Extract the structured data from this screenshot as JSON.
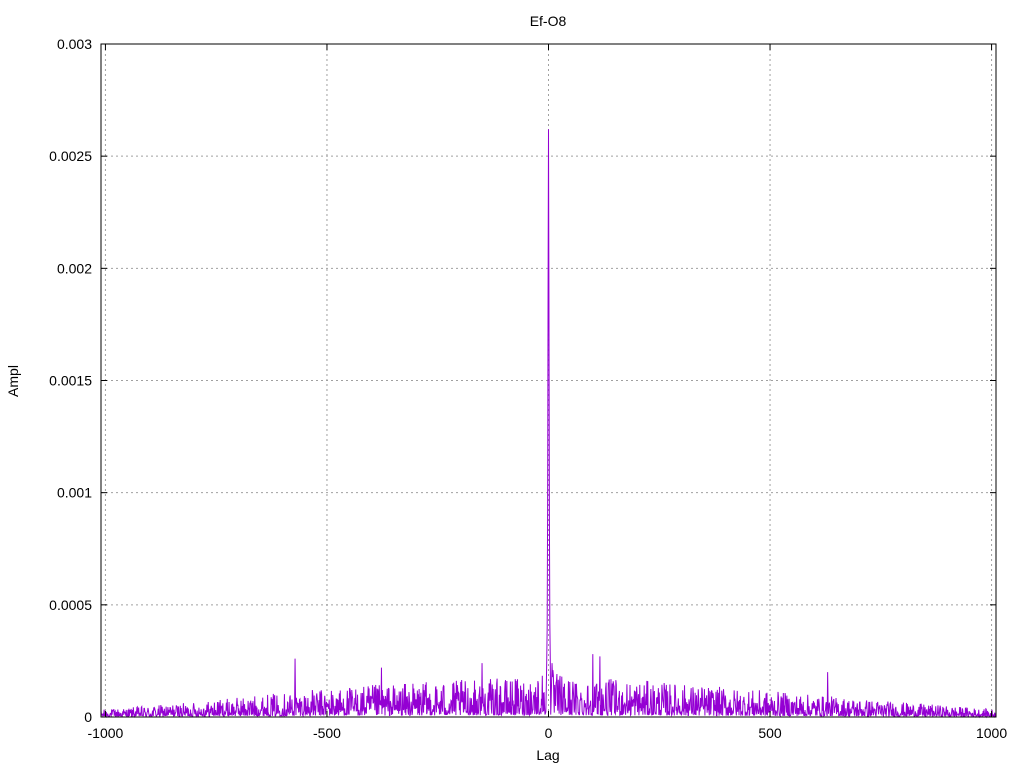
{
  "chart_data": {
    "type": "line",
    "title": "Ef-O8",
    "xlabel": "Lag",
    "ylabel": "Ampl",
    "xlim": [
      -1010,
      1010
    ],
    "ylim": [
      0,
      0.003
    ],
    "grid": true,
    "x_ticks": [
      "-1000",
      "-500",
      "0",
      "500",
      "1000"
    ],
    "y_ticks": [
      "0",
      "0.0005",
      "0.001",
      "0.0015",
      "0.002",
      "0.0025",
      "0.003"
    ],
    "series": [
      {
        "color": "#9400d3",
        "noise_profile": {
          "lag_min": -1010,
          "lag_max": 1010,
          "envelope_lags": [
            -1010,
            -800,
            -600,
            -400,
            -200,
            -50,
            0,
            50,
            200,
            400,
            600,
            800,
            1010
          ],
          "envelope_ampl": [
            3e-05,
            6e-05,
            0.0001,
            0.00013,
            0.00015,
            0.00016,
            0.0002,
            0.00016,
            0.00015,
            0.00012,
            9e-05,
            6e-05,
            3e-05
          ]
        },
        "peaks": [
          {
            "x": -4,
            "y": 0.00025
          },
          {
            "x": -3,
            "y": 0.0004
          },
          {
            "x": -2,
            "y": 0.00092
          },
          {
            "x": -1,
            "y": 0.00187
          },
          {
            "x": 0,
            "y": 0.00262
          },
          {
            "x": 1,
            "y": 0.00186
          },
          {
            "x": 2,
            "y": 0.0009
          },
          {
            "x": 3,
            "y": 0.00042
          },
          {
            "x": 4,
            "y": 0.00026
          },
          {
            "x": 8,
            "y": 0.00024
          },
          {
            "x": -572,
            "y": 0.00026
          },
          {
            "x": -377,
            "y": 0.00022
          },
          {
            "x": -150,
            "y": 0.00024
          },
          {
            "x": 100,
            "y": 0.00028
          },
          {
            "x": 116,
            "y": 0.00027
          },
          {
            "x": 630,
            "y": 0.0002
          }
        ]
      }
    ]
  }
}
